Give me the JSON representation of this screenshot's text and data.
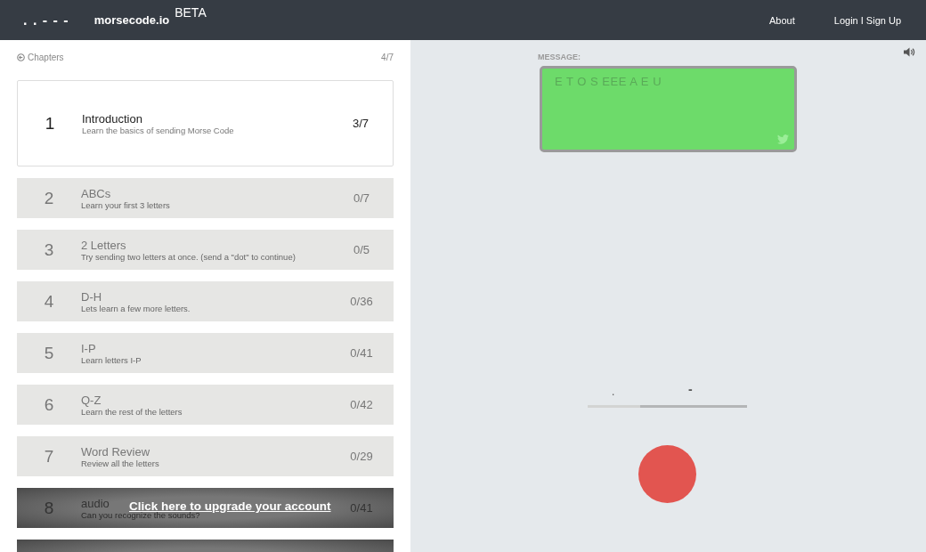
{
  "header": {
    "logo_mark": ". . - - -",
    "brand": "morsecode.io",
    "badge": "BETA",
    "nav": [
      "About",
      "Login I Sign Up"
    ]
  },
  "chapters": {
    "back_label": "Chapters",
    "progress": "4/7",
    "items": [
      {
        "number": "1",
        "title": "Introduction",
        "subtitle": "Learn the basics of sending Morse Code",
        "score": "3/7",
        "selected": true,
        "locked": false
      },
      {
        "number": "2",
        "title": "ABCs",
        "subtitle": "Learn your first 3 letters",
        "score": "0/7",
        "selected": false,
        "locked": false
      },
      {
        "number": "3",
        "title": "2 Letters",
        "subtitle": "Try sending two letters at once. (send a \"dot\" to continue)",
        "score": "0/5",
        "selected": false,
        "locked": false
      },
      {
        "number": "4",
        "title": "D-H",
        "subtitle": "Lets learn a few more letters.",
        "score": "0/36",
        "selected": false,
        "locked": false
      },
      {
        "number": "5",
        "title": "I-P",
        "subtitle": "Learn letters I-P",
        "score": "0/41",
        "selected": false,
        "locked": false
      },
      {
        "number": "6",
        "title": "Q-Z",
        "subtitle": "Learn the rest of the letters",
        "score": "0/42",
        "selected": false,
        "locked": false
      },
      {
        "number": "7",
        "title": "Word Review",
        "subtitle": "Review all the letters",
        "score": "0/29",
        "selected": false,
        "locked": false
      },
      {
        "number": "8",
        "title": "audio",
        "subtitle": "Can you recognize the sounds?",
        "score": "0/41",
        "selected": false,
        "locked": true,
        "upgrade_link": "Click here to upgrade your account"
      },
      {
        "selected": false,
        "locked": true
      }
    ]
  },
  "message": {
    "label": "MESSAGE:",
    "text": "E T O S EEE A E U"
  },
  "timing": {
    "dot_label": ".",
    "dash_label": "-",
    "level": 0.33
  }
}
